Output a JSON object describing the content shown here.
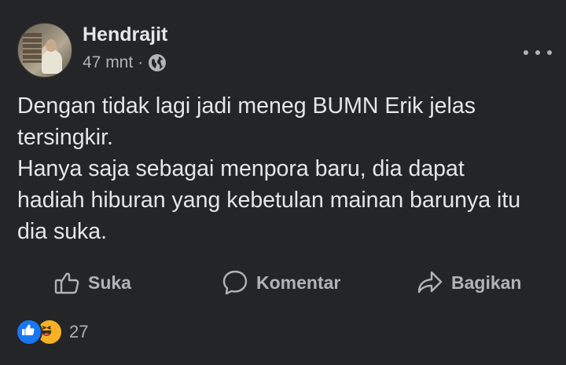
{
  "post": {
    "author": "Hendrajit",
    "time": "47 mnt",
    "separator": "·",
    "privacy_icon": "globe-icon",
    "more_icon": "more-horizontal-icon",
    "text_lines": [
      "Dengan tidak lagi jadi meneg BUMN Erik jelas",
      "tersingkir.",
      "Hanya saja sebagai menpora baru, dia dapat",
      "hadiah hiburan yang kebetulan mainan barunya itu",
      "dia suka."
    ]
  },
  "actions": {
    "like": {
      "label": "Suka",
      "icon": "thumbs-up-icon"
    },
    "comment": {
      "label": "Komentar",
      "icon": "comment-bubble-icon"
    },
    "share": {
      "label": "Bagikan",
      "icon": "share-arrow-icon"
    }
  },
  "reactions": {
    "icons": [
      "like-reaction-icon",
      "haha-reaction-icon"
    ],
    "count": "27",
    "colors": {
      "like": "#1877f2",
      "haha": "#f7b125"
    }
  },
  "theme": {
    "background": "#242526",
    "text": "#e4e6eb",
    "secondary": "#b0b3b8"
  }
}
